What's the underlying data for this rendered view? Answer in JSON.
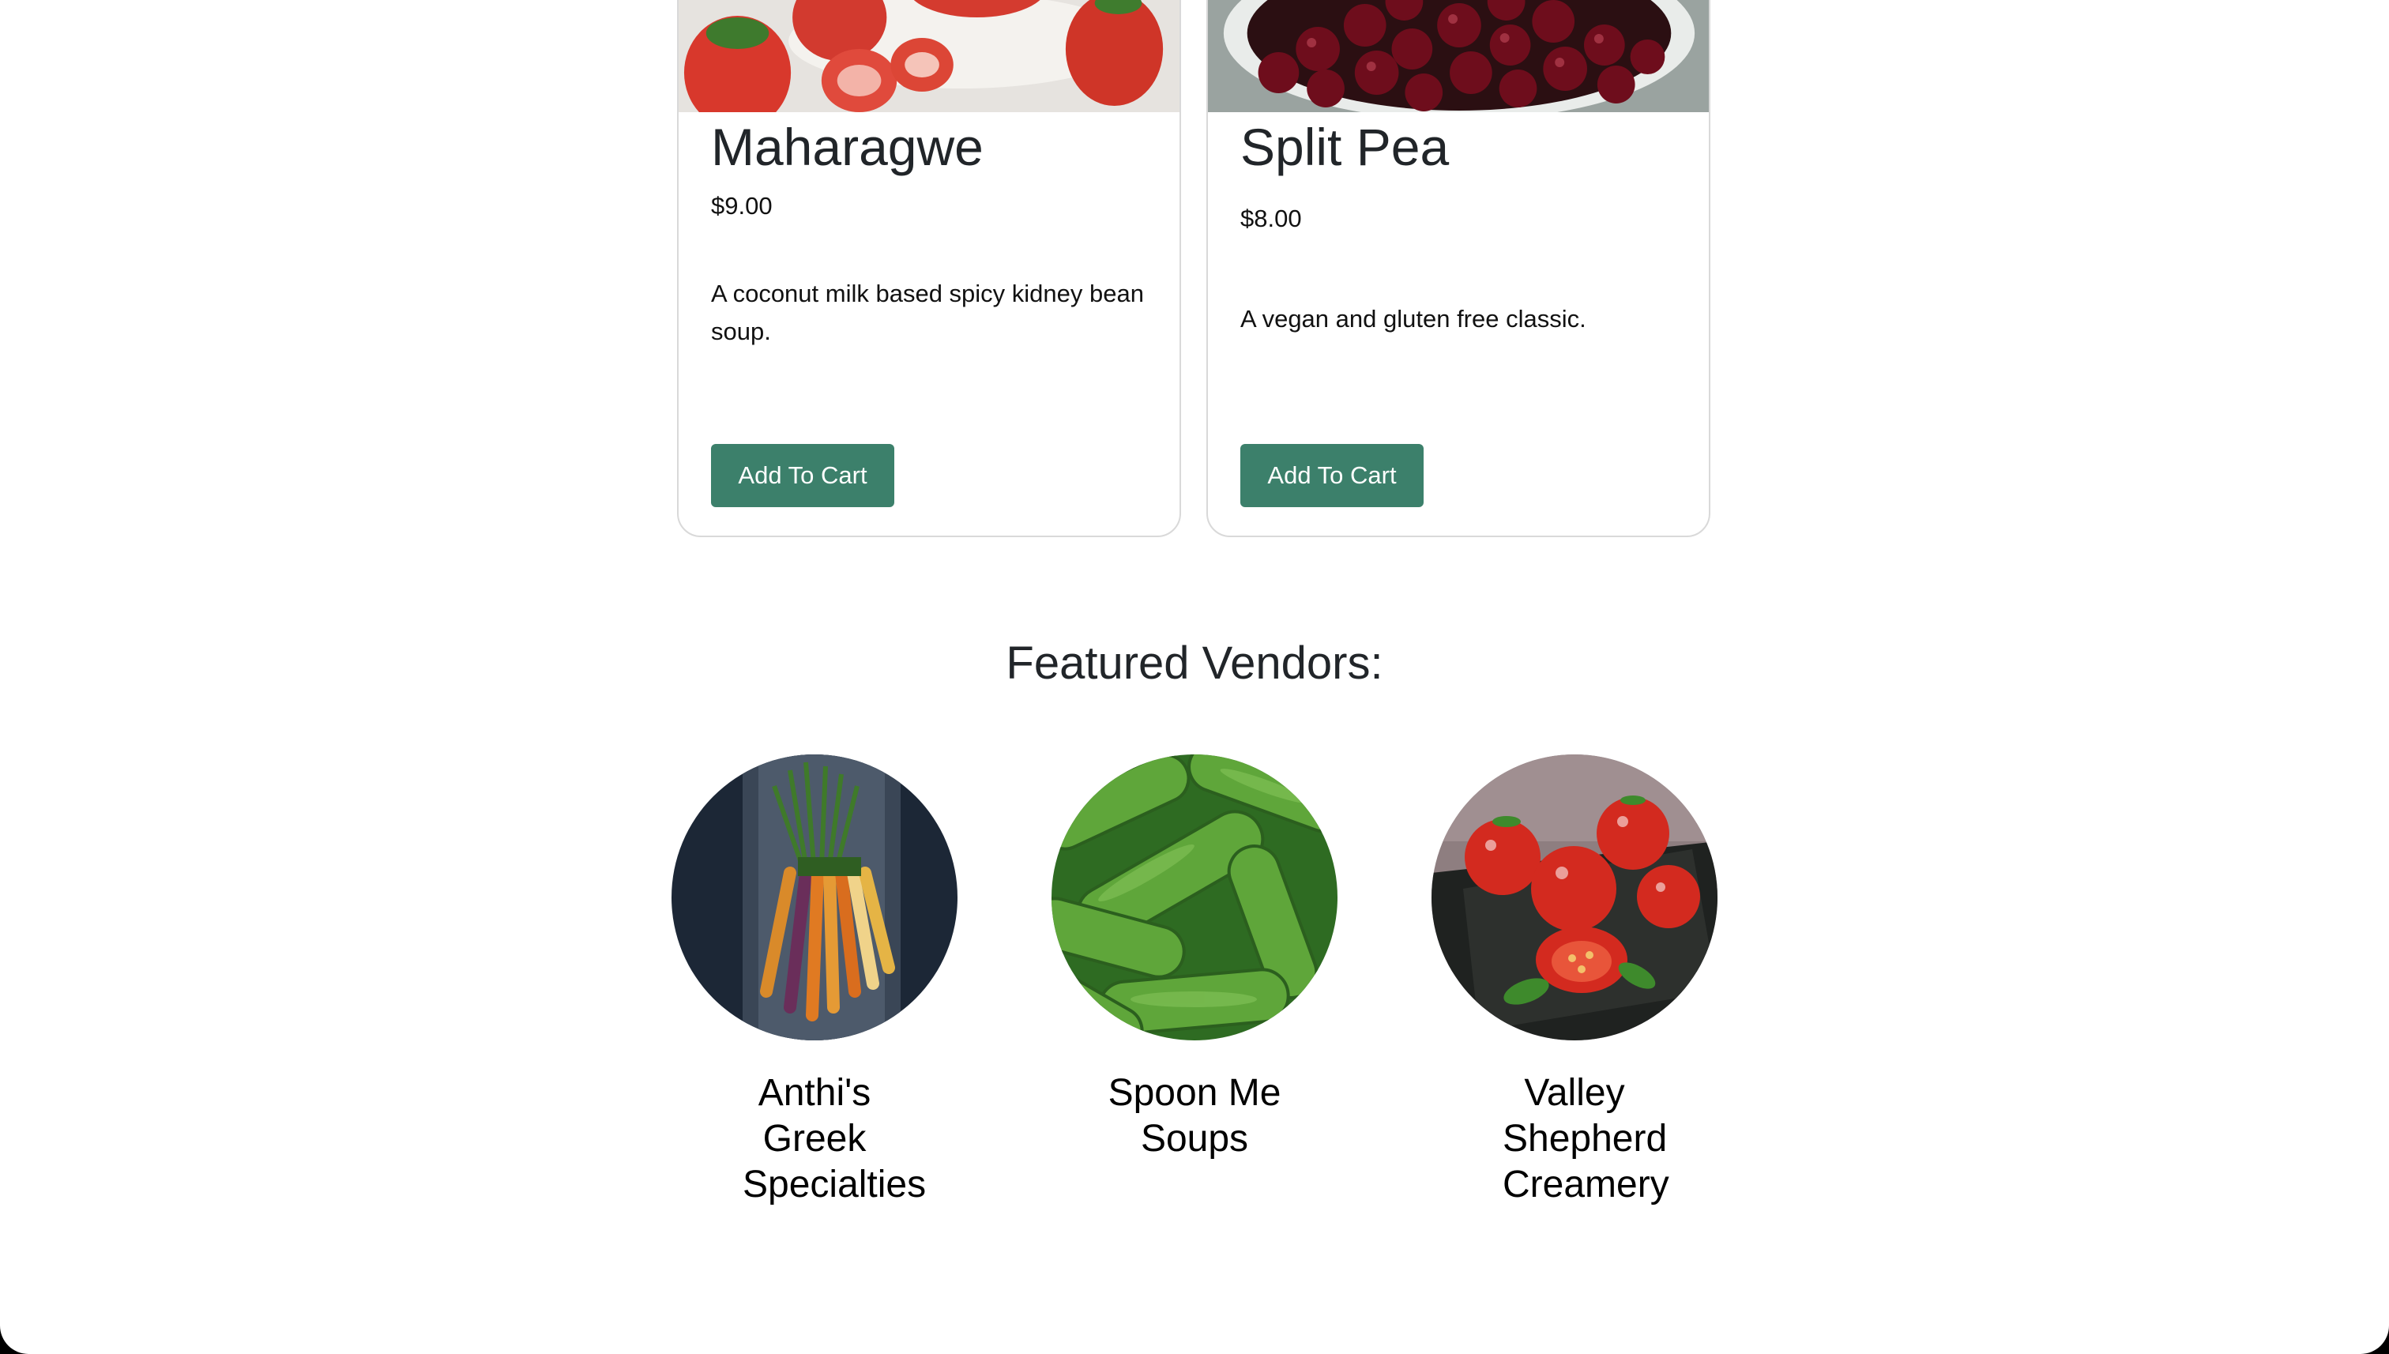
{
  "products": [
    {
      "name": "Maharagwe",
      "price": "$9.00",
      "description": "A coconut milk based spicy kidney bean soup.",
      "button_label": "Add To Cart",
      "image_subject": "strawberries"
    },
    {
      "name": "Split Pea",
      "price": "$8.00",
      "description": "A vegan and gluten free classic.",
      "button_label": "Add To Cart",
      "image_subject": "cherries"
    }
  ],
  "featured": {
    "title": "Featured Vendors:",
    "vendors": [
      {
        "name": "Anthi's Greek Specialties",
        "image_subject": "carrots"
      },
      {
        "name": "Spoon Me Soups",
        "image_subject": "cucumbers"
      },
      {
        "name": "Valley Shepherd Creamery",
        "image_subject": "tomatoes"
      }
    ]
  },
  "colors": {
    "button": "#3c806b",
    "page_background": "#ffffff",
    "frame": "#000000"
  }
}
